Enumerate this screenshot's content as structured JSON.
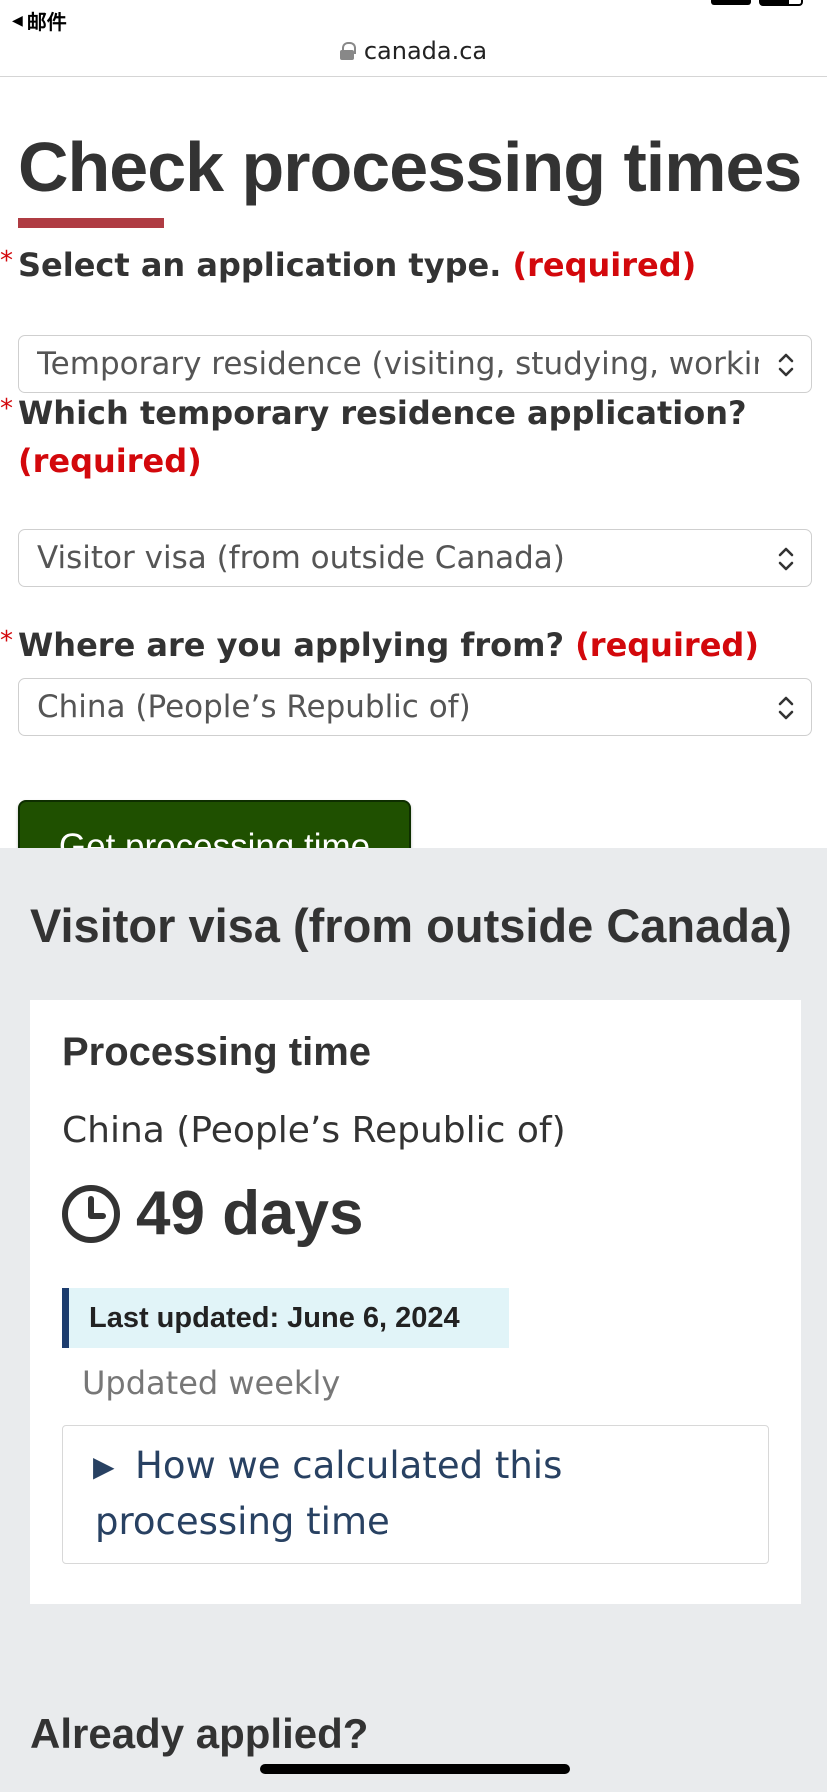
{
  "statusbar": {
    "back_app_label": "邮件"
  },
  "browser": {
    "url": "canada.ca"
  },
  "page": {
    "title": "Check processing times"
  },
  "form": {
    "field1": {
      "label": "Select an application type.",
      "required": "(required)",
      "value": "Temporary residence (visiting, studying, working)"
    },
    "field2": {
      "label": "Which temporary residence application?",
      "required": "(required)",
      "value": "Visitor visa (from outside Canada)"
    },
    "field3": {
      "label": "Where are you applying from?",
      "required": "(required)",
      "value": "China (People’s Republic of)"
    },
    "submit_label": "Get processing time"
  },
  "result": {
    "heading": "Visitor visa (from outside Canada)",
    "card": {
      "subheading": "Processing time",
      "country": "China (People’s Republic of)",
      "duration": "49 days",
      "last_updated": "Last updated: June 6, 2024",
      "update_frequency": "Updated weekly",
      "details_summary": "How we calculated this processing time"
    },
    "next_heading": "Already applied?"
  },
  "colors": {
    "accent_rule": "#af3c43",
    "required_red": "#d3080c",
    "button_green": "#1f5000",
    "link_blue": "#284162",
    "updated_bg": "#e1f4f8"
  }
}
